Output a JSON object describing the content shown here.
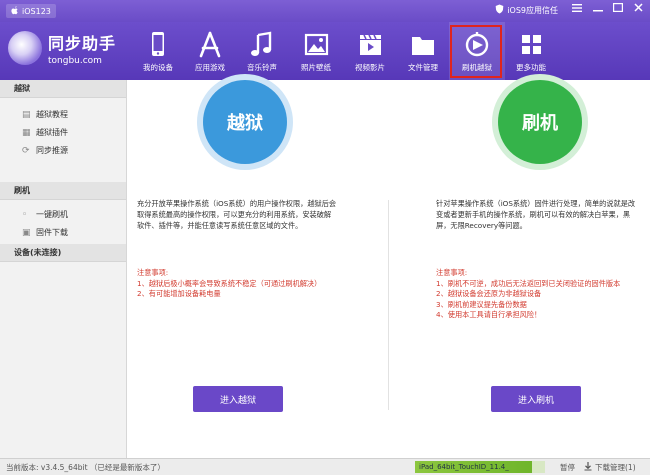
{
  "titlebar": {
    "device_name": "iOS123",
    "trust_label": "iOS9应用信任",
    "icons": [
      "apple-icon",
      "shield-icon",
      "menu-icon",
      "minimize-icon",
      "maximize-icon",
      "close-icon"
    ]
  },
  "logo": {
    "name": "同步助手",
    "domain": "tongbu.com"
  },
  "nav": [
    {
      "label": "我的设备",
      "icon": "phone-icon"
    },
    {
      "label": "应用游戏",
      "icon": "app-store-icon"
    },
    {
      "label": "音乐铃声",
      "icon": "music-note-icon"
    },
    {
      "label": "照片壁纸",
      "icon": "photo-icon"
    },
    {
      "label": "视频影片",
      "icon": "clapperboard-icon"
    },
    {
      "label": "文件管理",
      "icon": "folder-icon"
    },
    {
      "label": "刷机越狱",
      "icon": "flash-jailbreak-icon",
      "selected": true
    },
    {
      "label": "更多功能",
      "icon": "grid-icon"
    }
  ],
  "sidebar": {
    "jailbreak_header": "越狱",
    "jailbreak_items": [
      "越狱教程",
      "越狱插件",
      "同步推源"
    ],
    "flash_header": "刷机",
    "flash_items": [
      "一键刷机",
      "固件下载"
    ],
    "device_header": "设备(未连接)"
  },
  "jailbreak": {
    "circle_label": "越狱",
    "description": "充分开放苹果操作系统（iOS系统）的用户操作权限，越狱后会取得系统最高的操作权限，可以更充分的利用系统，安装破解软件、插件等，并能任意读写系统任意区域的文件。",
    "notes_title": "注意事项:",
    "notes": [
      "1、越狱后极小概率会导致系统不稳定（可通过刷机解决）",
      "2、有可能增加设备耗电量"
    ],
    "button": "进入越狱"
  },
  "flash": {
    "circle_label": "刷机",
    "description": "针对苹果操作系统（iOS系统）固件进行处理，简单的说就是改变或者更新手机的操作系统，刷机可以有效的解决白苹果，黑屏，无限Recovery等问题。",
    "notes_title": "注意事项:",
    "notes": [
      "1、刷机不可逆，成功后无法返回到已关闭验证的固件版本",
      "2、越狱设备会还原为非越狱设备",
      "3、刷机前建议提先备份数据",
      "4、使用本工具请自行承担风险！"
    ],
    "button": "进入刷机"
  },
  "status": {
    "version": "当前版本: v3.4.5_64bit （已经是最新版本了）",
    "download": "iPad_64bit_TouchID_11.4_",
    "download_progress": 0.9,
    "pause": "暂停",
    "download_manager": "下载管理(1)"
  },
  "colors": {
    "accent": "#6a48c8",
    "jailbreak_circle": "#3b99dc",
    "flash_circle": "#35b34a",
    "note_red": "#d23a2e"
  }
}
